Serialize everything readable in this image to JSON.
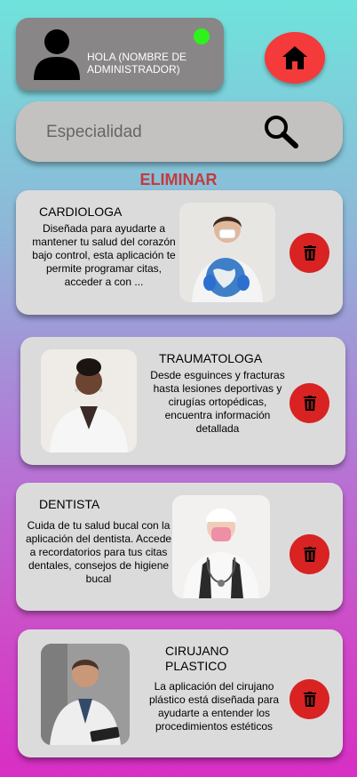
{
  "header": {
    "greeting": "HOLA (NOMBRE DE ADMINISTRADOR)",
    "avatar_icon": "user-icon",
    "status_color": "#2ef21c",
    "home_icon": "home-icon",
    "home_color": "#f43a3a"
  },
  "search": {
    "placeholder": "Especialidad",
    "icon": "search-icon"
  },
  "heading": "ELIMINAR",
  "cards": [
    {
      "title": "CARDIOLOGA",
      "description": "Diseñada para ayudarte a mantener tu salud del corazón bajo control, esta aplicación te permite programar citas, acceder a con ...",
      "photo": "doctor-holding-globe",
      "action_icon": "trash-icon"
    },
    {
      "title": "TRAUMATOLOGA",
      "description": "Desde esguinces y fracturas hasta lesiones deportivas y cirugías ortopédicas, encuentra información detallada",
      "photo": "doctor-white-coat",
      "action_icon": "trash-icon"
    },
    {
      "title": "DENTISTA",
      "description": "Cuida de tu salud bucal con la aplicación del dentista. Accede a recordatorios para tus citas dentales, consejos de higiene bucal",
      "photo": "doctor-pink-mask",
      "action_icon": "trash-icon"
    },
    {
      "title": "CIRUJANO PLASTICO",
      "description": "La aplicación del cirujano plástico está diseñada para ayudarte a entender los procedimientos estéticos",
      "photo": "doctor-with-tablet",
      "action_icon": "trash-icon"
    }
  ]
}
